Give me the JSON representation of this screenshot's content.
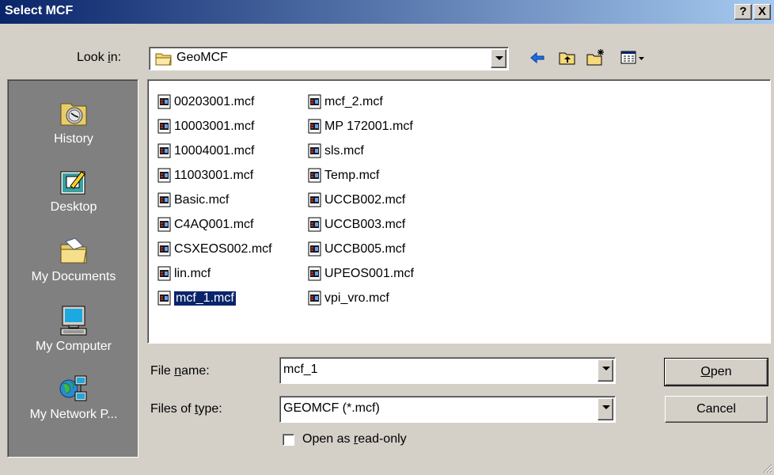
{
  "window": {
    "title": "Select MCF",
    "help_label": "?",
    "close_label": "X"
  },
  "look_in": {
    "label_before": "Look ",
    "label_accel": "i",
    "label_after": "n:",
    "value": "GeoMCF"
  },
  "toolbar": {
    "buttons": [
      "back-icon",
      "up-folder-icon",
      "new-folder-icon",
      "view-menu-icon"
    ]
  },
  "places": [
    {
      "label": "History",
      "icon": "history-icon"
    },
    {
      "label": "Desktop",
      "icon": "desktop-icon"
    },
    {
      "label": "My Documents",
      "icon": "my-documents-icon"
    },
    {
      "label": "My Computer",
      "icon": "my-computer-icon"
    },
    {
      "label": "My Network P...",
      "icon": "network-places-icon"
    }
  ],
  "files": {
    "column1": [
      "00203001.mcf",
      "10003001.mcf",
      "10004001.mcf",
      "11003001.mcf",
      "Basic.mcf",
      "C4AQ001.mcf",
      "CSXEOS002.mcf",
      "lin.mcf",
      "mcf_1.mcf"
    ],
    "column2": [
      "mcf_2.mcf",
      "MP 172001.mcf",
      "sls.mcf",
      "Temp.mcf",
      "UCCB002.mcf",
      "UCCB003.mcf",
      "UCCB005.mcf",
      "UPEOS001.mcf",
      "vpi_vro.mcf"
    ],
    "selected": "mcf_1.mcf"
  },
  "file_name": {
    "label_before": "File ",
    "label_accel": "n",
    "label_after": "ame:",
    "value": "mcf_1"
  },
  "file_type": {
    "label_before": "Files of ",
    "label_accel": "t",
    "label_after": "ype:",
    "value": "GEOMCF (*.mcf)"
  },
  "read_only": {
    "label_before": "Open as ",
    "label_accel": "r",
    "label_after": "ead-only",
    "checked": false
  },
  "buttons": {
    "open_accel": "O",
    "open_rest": "pen",
    "cancel": "Cancel"
  },
  "colors": {
    "title_gradient_start": "#0a246a",
    "title_gradient_end": "#a6caf0",
    "dialog_bg": "#d4d0c8",
    "places_bg": "#808080",
    "selection": "#0a246a"
  }
}
